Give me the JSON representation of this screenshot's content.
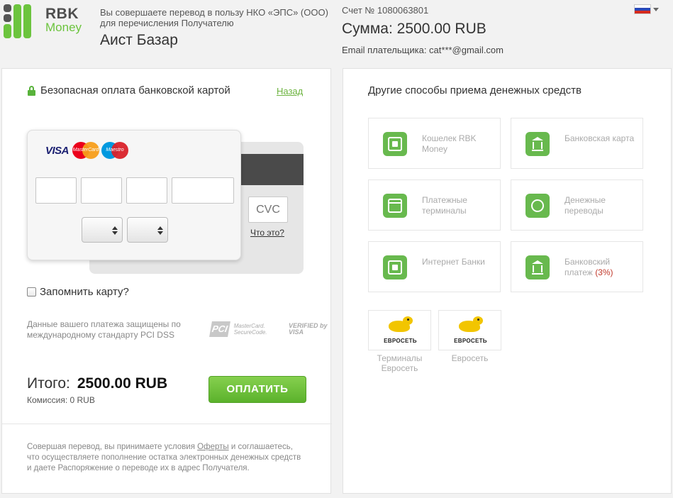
{
  "header": {
    "logo_top": "RBK",
    "logo_bottom": "Money",
    "recipient_desc": "Вы совершаете перевод в пользу НКО «ЭПС» (ООО) для перечисления Получателю",
    "recipient_name": "Аист Базар",
    "invoice": "Счет № 1080063801",
    "amount": "Сумма: 2500.00 RUB",
    "email": "Email плательщика: cat***@gmail.com"
  },
  "card_form": {
    "title": "Безопасная оплата банковской картой",
    "back_link": "Назад",
    "brand_visa": "VISA",
    "brand_mastercard": "MasterCard",
    "brand_maestro": "Maestro",
    "cvc_placeholder": "CVC",
    "what_is_it": "Что это?",
    "remember_card": "Запомнить карту?",
    "pci_text": "Данные вашего платежа защищены по международному стандарту PCI DSS",
    "pci_logo": "PCI",
    "mc_securecode": "MasterCard. SecureCode.",
    "verified_visa": "VERIFIED by VISA",
    "total_label": "Итого:",
    "total_value": "2500.00 RUB",
    "commission": "Комиссия: 0 RUB",
    "pay_button": "ОПЛАТИТЬ",
    "terms_before": "Совершая перевод, вы принимаете условия ",
    "terms_link": "Оферты",
    "terms_after": " и соглашаетесь, что осуществляете пополнение остатка электронных денежных средств и даете Распоряжение о переводе их в адрес Получателя."
  },
  "other_methods": {
    "title": "Другие способы приема денежных средств",
    "items": [
      {
        "label": "Кошелек RBK Money",
        "icon": "wallet-icon"
      },
      {
        "label": "Банковская карта",
        "icon": "bank-icon"
      },
      {
        "label": "Платежные терминалы",
        "icon": "terminal-icon"
      },
      {
        "label": "Денежные переводы",
        "icon": "transfer-icon"
      },
      {
        "label": "Интернет Банки",
        "icon": "safe-icon"
      },
      {
        "label": "Банковский платеж",
        "extra": "(3%)",
        "icon": "bank-icon"
      }
    ],
    "euroset_brand": "ЕВРОСЕТЬ",
    "euroset_items": [
      {
        "label": "Терминалы Евросеть"
      },
      {
        "label": "Евросеть"
      }
    ]
  },
  "colors": {
    "brand_green": "#6cc43e",
    "accent_green": "#58b23b",
    "danger": "#c0392b"
  }
}
